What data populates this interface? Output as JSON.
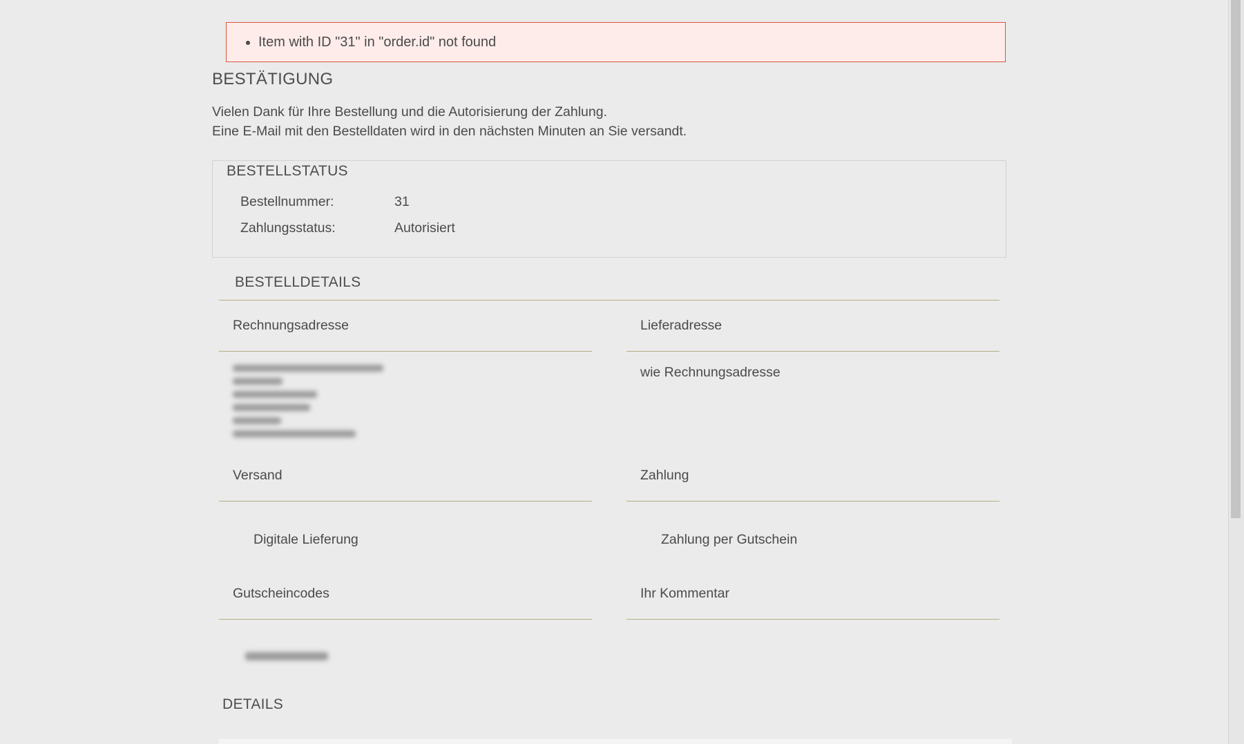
{
  "alert": {
    "message": "Item with ID \"31\" in \"order.id\" not found"
  },
  "confirmation": {
    "title": "BESTÄTIGUNG",
    "line1": "Vielen Dank für Ihre Bestellung und die Autorisierung der Zahlung.",
    "line2": "Eine E-Mail mit den Bestelldaten wird in den nächsten Minuten an Sie versandt."
  },
  "order_status": {
    "title": "BESTELLSTATUS",
    "order_number_label": "Bestellnummer:",
    "order_number_value": "31",
    "payment_status_label": "Zahlungsstatus:",
    "payment_status_value": "Autorisiert"
  },
  "order_details": {
    "title": "BESTELLDETAILS",
    "billing_address_title": "Rechnungsadresse",
    "shipping_address_title": "Lieferadresse",
    "shipping_address_value": "wie Rechnungsadresse",
    "shipping_title": "Versand",
    "shipping_value": "Digitale Lieferung",
    "payment_title": "Zahlung",
    "payment_value": "Zahlung per Gutschein",
    "voucher_codes_title": "Gutscheincodes",
    "comment_title": "Ihr Kommentar"
  },
  "details": {
    "title": "DETAILS"
  }
}
